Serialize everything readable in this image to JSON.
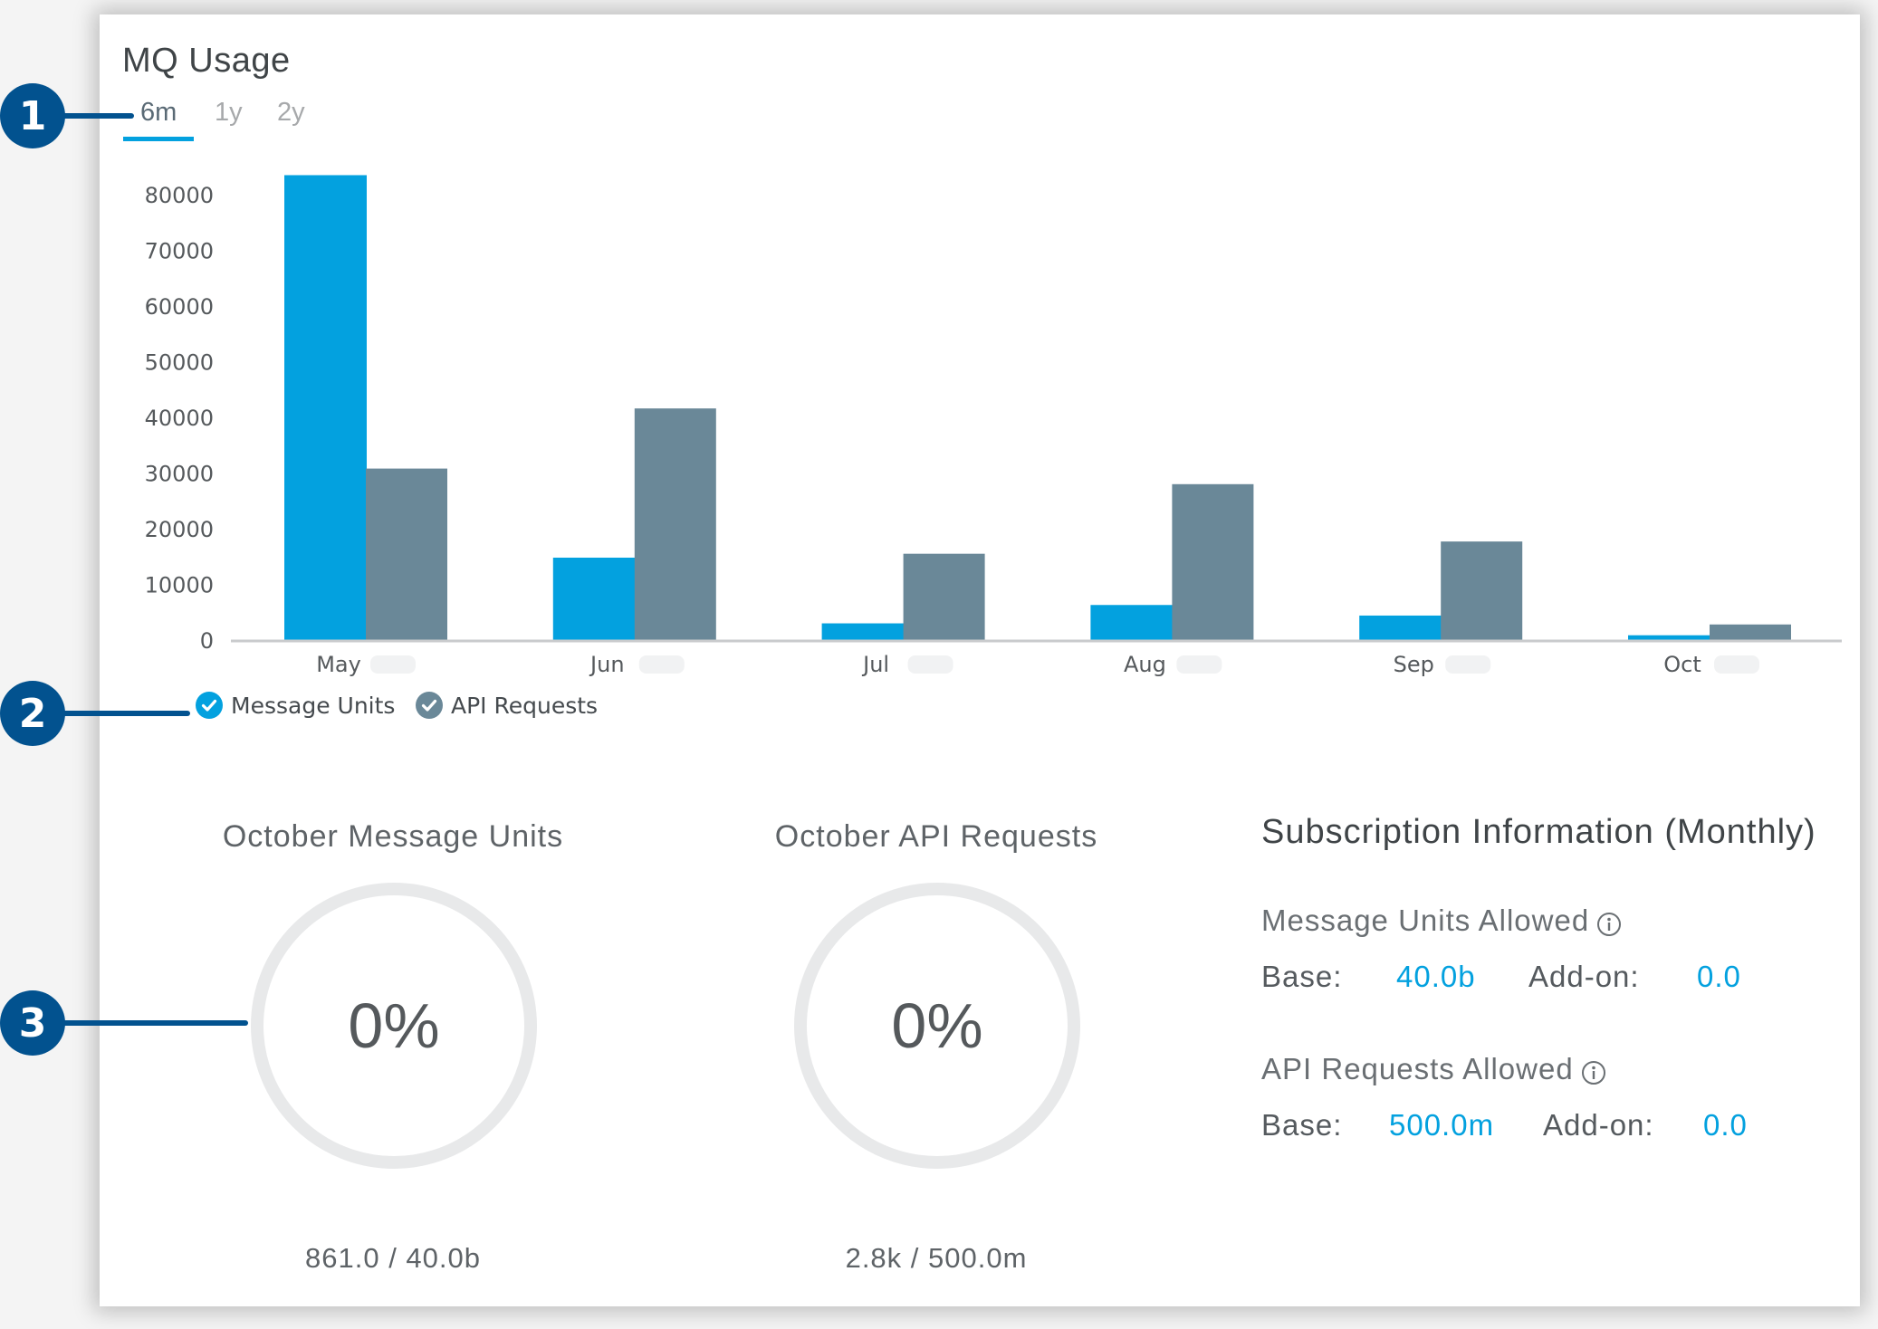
{
  "card": {
    "title": "MQ Usage",
    "tabs": [
      {
        "label": "6m",
        "active": true
      },
      {
        "label": "1y",
        "active": false
      },
      {
        "label": "2y",
        "active": false
      }
    ]
  },
  "chart_data": {
    "type": "bar",
    "title": "MQ Usage",
    "xlabel": "",
    "ylabel": "",
    "categories": [
      "May",
      "Jun",
      "Jul",
      "Aug",
      "Sep",
      "Oct"
    ],
    "category_year_hidden": true,
    "series": [
      {
        "name": "Message Units",
        "color": "#03A1DF",
        "values": [
          83500,
          14800,
          3000,
          6300,
          4400,
          861
        ]
      },
      {
        "name": "API Requests",
        "color": "#6A8898",
        "values": [
          30800,
          41600,
          15500,
          28000,
          17700,
          2800
        ]
      }
    ],
    "yticks": [
      0,
      10000,
      20000,
      30000,
      40000,
      50000,
      60000,
      70000,
      80000
    ],
    "ylim": [
      0,
      80000
    ],
    "grid": false,
    "legend": "bottom-left"
  },
  "legend": [
    {
      "label": "Message Units",
      "checked": true,
      "color": "#03A1DF"
    },
    {
      "label": "API Requests",
      "checked": true,
      "color": "#6A8898"
    }
  ],
  "gauges": [
    {
      "title": "October Message Units",
      "percent_text": "0%",
      "percent": 0,
      "footer": "861.0 / 40.0b"
    },
    {
      "title": "October API Requests",
      "percent_text": "0%",
      "percent": 0,
      "footer": "2.8k / 500.0m"
    }
  ],
  "subscription": {
    "title": "Subscription Information (Monthly)",
    "sections": [
      {
        "label": "Message Units Allowed",
        "info_icon": "info-icon",
        "base_label": "Base:",
        "base_value": "40.0b",
        "addon_label": "Add-on:",
        "addon_value": "0.0"
      },
      {
        "label": "API Requests Allowed",
        "info_icon": "info-icon",
        "base_label": "Base:",
        "base_value": "500.0m",
        "addon_label": "Add-on:",
        "addon_value": "0.0"
      }
    ]
  },
  "callouts": [
    "1",
    "2",
    "3"
  ],
  "colors": {
    "accent": "#03A1DF",
    "secondary": "#6A8898",
    "callout": "#02528F",
    "ring_track": "#E8E9EA"
  }
}
